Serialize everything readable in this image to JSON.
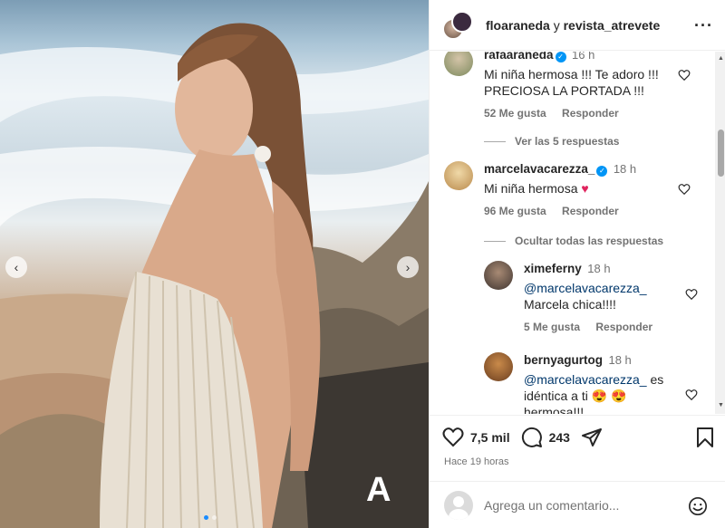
{
  "post": {
    "photo_mark": "A",
    "slide_count": 2,
    "active_slide": 0
  },
  "header": {
    "user1": "floaraneda",
    "conjunction": "y",
    "user2": "revista_atrevete",
    "more_icon": "more-horizontal-icon"
  },
  "comments": [
    {
      "user": "rafaaraneda",
      "verified": true,
      "time": "16 h",
      "text": "Mi niña hermosa !!! Te adoro !!! PRECIOSA LA PORTADA !!!",
      "likes": "52 Me gusta",
      "reply": "Responder",
      "replies_toggle": "Ver las 5 respuestas"
    },
    {
      "user": "marcelavacarezza_",
      "verified": true,
      "time": "18 h",
      "text": "Mi niña hermosa",
      "emoji": "♥",
      "likes": "96 Me gusta",
      "reply": "Responder",
      "replies_toggle": "Ocultar todas las respuestas"
    }
  ],
  "replies": [
    {
      "user": "ximeferny",
      "time": "18 h",
      "mention": "@marcelavacarezza_",
      "text": "Marcela chica!!!!",
      "likes": "5 Me gusta",
      "reply": "Responder"
    },
    {
      "user": "bernyagurtog",
      "time": "18 h",
      "mention": "@marcelavacarezza_",
      "text": " es idéntica a ti",
      "emoji": "😍 😍",
      "text2": "hermosa!!!"
    }
  ],
  "actions": {
    "likes": "7,5 mil",
    "comments": "243",
    "timestamp": "Hace 19 horas"
  },
  "add_comment": {
    "placeholder": "Agrega un comentario..."
  },
  "colors": {
    "verified": "#0095f6",
    "mention": "#00376b",
    "muted": "#737373",
    "slide_active": "#1a8cff"
  }
}
